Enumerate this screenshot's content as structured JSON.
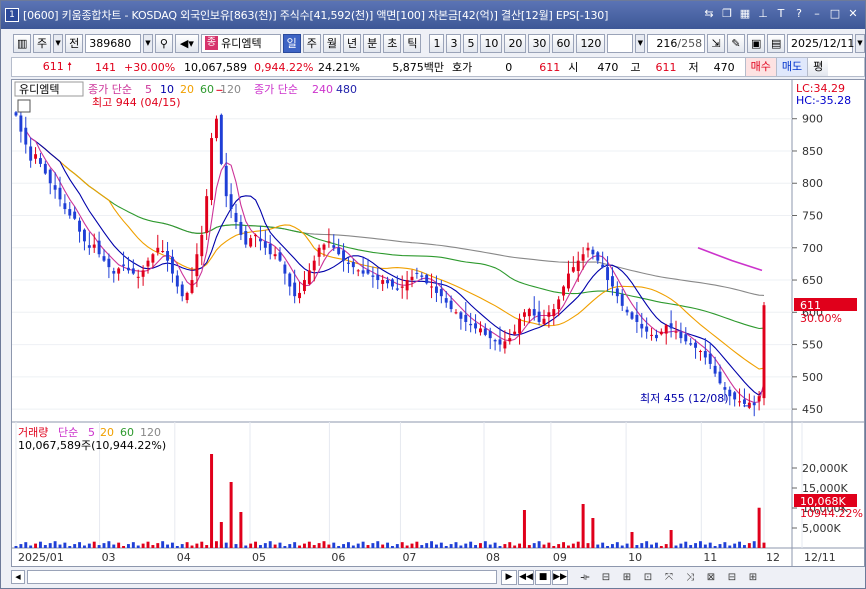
{
  "window": {
    "number": "1",
    "title": "[0600] 키움종합차트 - KOSDAQ 외국인보유[863(천)] 주식수[41,592(천)] 액면[100] 자본금[42(억)] 결산[12월] EPS[-130]"
  },
  "toolbar": {
    "type_btn": "주",
    "prev_btn": "전",
    "code": "389680",
    "stock_tag": "종",
    "stock_name": "유디엠텍",
    "periods": [
      "일",
      "주",
      "월",
      "년",
      "분",
      "초",
      "틱"
    ],
    "active_period": "일",
    "intervals": [
      "1",
      "3",
      "5",
      "10",
      "20",
      "30",
      "60",
      "120"
    ],
    "count": "216",
    "total": "/258",
    "date": "2025/12/11"
  },
  "quote": {
    "price": "611",
    "change": "141",
    "change_pct": "+30.00%",
    "volume": "10,067,589",
    "volume_ratio": "0,944.22%",
    "turnover": "24.21%",
    "amount": "5,875백만",
    "hoga_label": "호가",
    "hoga_value": "0",
    "hoga_price": "611",
    "open_label": "시",
    "open": "470",
    "high_label": "고",
    "high": "611",
    "low_label": "저",
    "low": "470",
    "buy_btn": "매수",
    "sell_btn": "매도",
    "eval_btn": "평"
  },
  "legend": {
    "name": "유디엠텍",
    "ma_price": "종가 단순",
    "ma_periods": [
      "5",
      "10",
      "20",
      "60",
      "120"
    ],
    "ma_price2": "종가 단순",
    "ma_periods2": [
      "240",
      "480"
    ],
    "high_note": "최고 944 (04/15)",
    "low_note": "최저 455 (12/08)",
    "lc": "LC:34.29",
    "hc": "HC:-35.28",
    "current_tag": "611",
    "current_pct": "30.00%"
  },
  "volume_panel": {
    "title": "거래량",
    "ma_label": "단순",
    "ma_periods": [
      "5",
      "20",
      "60",
      "120"
    ],
    "value_text": "10,067,589주(10,944.22%)",
    "current_tag": "10,068K",
    "current_pct": "10944.22%"
  },
  "colors": {
    "up": "#e0001b",
    "down": "#1f3fd6",
    "ma5": "#cc3399",
    "ma10": "#0000aa",
    "ma20": "#f0a000",
    "ma60": "#2e9a2e",
    "ma120": "#888888",
    "ma240": "#cc33cc",
    "ma480": "#2222aa"
  },
  "chart_data": {
    "type": "candlestick",
    "price_axis": {
      "ticks": [
        900,
        850,
        800,
        750,
        700,
        650,
        600,
        550,
        500,
        450
      ],
      "range": [
        430,
        960
      ]
    },
    "volume_axis": {
      "ticks": [
        "20,000K",
        "15,000K",
        "10,000K",
        "5,000K"
      ],
      "range": [
        0,
        24000
      ]
    },
    "x_ticks": [
      "2025/01",
      "03",
      "04",
      "05",
      "06",
      "07",
      "08",
      "09",
      "10",
      "11",
      "12",
      "12/11"
    ],
    "ma_legend": [
      "5",
      "10",
      "20",
      "60",
      "120",
      "240",
      "480"
    ],
    "high": {
      "value": 944,
      "date": "04/15"
    },
    "low": {
      "value": 455,
      "date": "12/08"
    },
    "last_close": 611,
    "last_volume_k": 10068,
    "price_path": [
      905,
      880,
      860,
      835,
      845,
      830,
      815,
      800,
      790,
      775,
      760,
      750,
      745,
      725,
      710,
      700,
      705,
      690,
      680,
      670,
      660,
      668,
      672,
      665,
      660,
      655,
      665,
      680,
      690,
      700,
      695,
      680,
      660,
      640,
      625,
      630,
      650,
      690,
      720,
      780,
      870,
      900,
      830,
      780,
      760,
      740,
      720,
      705,
      715,
      720,
      710,
      700,
      690,
      690,
      680,
      660,
      640,
      625,
      630,
      650,
      665,
      680,
      700,
      705,
      710,
      700,
      690,
      680,
      675,
      670,
      665,
      660,
      660,
      655,
      650,
      650,
      645,
      640,
      635,
      640,
      650,
      655,
      660,
      655,
      645,
      640,
      630,
      625,
      615,
      605,
      600,
      590,
      585,
      580,
      575,
      575,
      565,
      560,
      555,
      550,
      555,
      560,
      570,
      590,
      600,
      605,
      595,
      585,
      590,
      600,
      605,
      620,
      640,
      660,
      670,
      680,
      690,
      700,
      690,
      680,
      670,
      650,
      640,
      625,
      610,
      600,
      590,
      585,
      575,
      570,
      565,
      560,
      570,
      580,
      575,
      570,
      560,
      555,
      550,
      545,
      540,
      530,
      520,
      505,
      490,
      480,
      470,
      465,
      462,
      458,
      460,
      456,
      470,
      611
    ],
    "volume_spikes": [
      {
        "i": 40,
        "v": 23500
      },
      {
        "i": 44,
        "v": 16500
      },
      {
        "i": 42,
        "v": 6500
      },
      {
        "i": 46,
        "v": 9000
      },
      {
        "i": 104,
        "v": 9500
      },
      {
        "i": 116,
        "v": 11000
      },
      {
        "i": 118,
        "v": 7500
      },
      {
        "i": 126,
        "v": 4000
      },
      {
        "i": 134,
        "v": 4500
      },
      {
        "i": 152,
        "v": 10068
      }
    ]
  }
}
